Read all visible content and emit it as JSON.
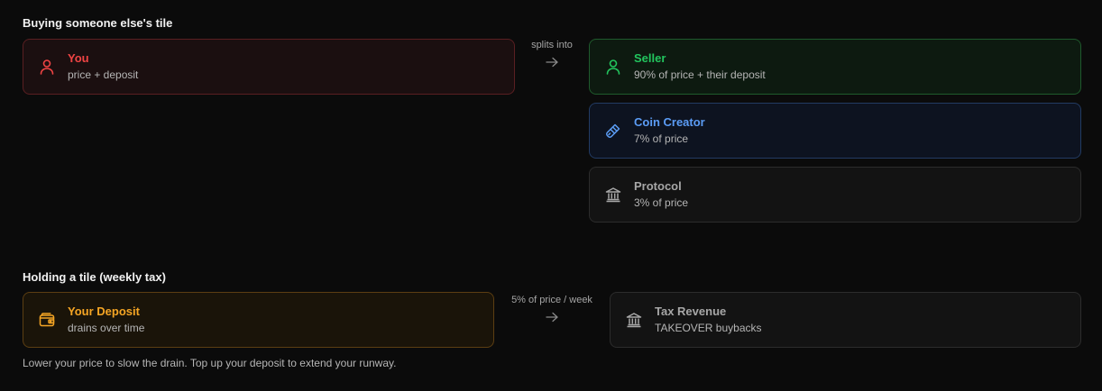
{
  "buy_section": {
    "title": "Buying someone else's tile",
    "you": {
      "title": "You",
      "sub": "price + deposit",
      "icon": "user-icon"
    },
    "connector_label": "splits into",
    "seller": {
      "title": "Seller",
      "sub": "90% of price + their deposit",
      "icon": "user-icon"
    },
    "creator": {
      "title": "Coin Creator",
      "sub": "7% of price",
      "icon": "brush-icon"
    },
    "protocol": {
      "title": "Protocol",
      "sub": "3% of price",
      "icon": "bank-icon"
    }
  },
  "hold_section": {
    "title": "Holding a tile (weekly tax)",
    "deposit": {
      "title": "Your Deposit",
      "sub": "drains over time",
      "icon": "wallet-icon"
    },
    "connector_label": "5% of price / week",
    "tax": {
      "title": "Tax Revenue",
      "sub": "TAKEOVER buybacks",
      "icon": "bank-icon"
    },
    "footnote": "Lower your price to slow the drain. Top up your deposit to extend your runway."
  },
  "colors": {
    "red": "#ef4444",
    "green": "#22c55e",
    "blue": "#5b9cf5",
    "gray": "#a7a7a7",
    "amber": "#f5a524"
  }
}
